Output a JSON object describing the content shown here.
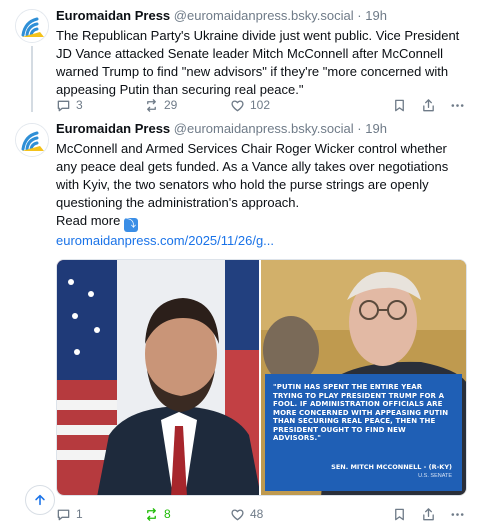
{
  "colors": {
    "accent": "#1a73e8",
    "repost_active": "#20bc07",
    "muted": "#6f7b88",
    "quote_bg": "#1f5fb5"
  },
  "posts": [
    {
      "author_name": "Euromaidan Press",
      "author_handle": "@euromaidanpress.bsky.social",
      "separator": "·",
      "time": "19h",
      "text": "The Republican Party's Ukraine divide just went public. Vice President JD Vance attacked Senate leader Mitch McConnell after McConnell warned Trump to find \"new advisors\" if they're \"more concerned with appeasing Putin than securing real peace.\"",
      "reply_count": "3",
      "repost_count": "29",
      "like_count": "102"
    },
    {
      "author_name": "Euromaidan Press",
      "author_handle": "@euromaidanpress.bsky.social",
      "separator": "·",
      "time": "19h",
      "text": "McConnell and Armed Services Chair Roger Wicker control whether any peace deal gets funded. As a Vance ally takes over negotiations with Kyiv, the two senators who hold the purse strings are openly questioning the administration's approach.",
      "read_more": "Read more",
      "read_more_emoji": "⤵",
      "link_text": "euromaidanpress.com/2025/11/26/g...",
      "image_quote": "\"PUTIN HAS SPENT THE ENTIRE YEAR TRYING TO PLAY PRESIDENT TRUMP FOR A FOOL. IF ADMINISTRATION OFFICIALS ARE MORE CONCERNED WITH APPEASING PUTIN THAN SECURING REAL PEACE, THEN THE PRESIDENT OUGHT TO FIND NEW ADVISORS.\"",
      "image_quote_attribution": "SEN. MITCH MCCONNELL - (R-KY)",
      "image_quote_source": "U.S. SENATE",
      "reply_count": "1",
      "repost_count": "8",
      "like_count": "48"
    }
  ],
  "icons": {
    "avatar": "euromaidan-press-logo",
    "reply": "speech-bubble-icon",
    "repost": "repost-arrows-icon",
    "like": "heart-icon",
    "bookmark": "bookmark-icon",
    "share": "share-upload-icon",
    "more": "ellipsis-icon",
    "scroll_top": "arrow-up-icon"
  }
}
